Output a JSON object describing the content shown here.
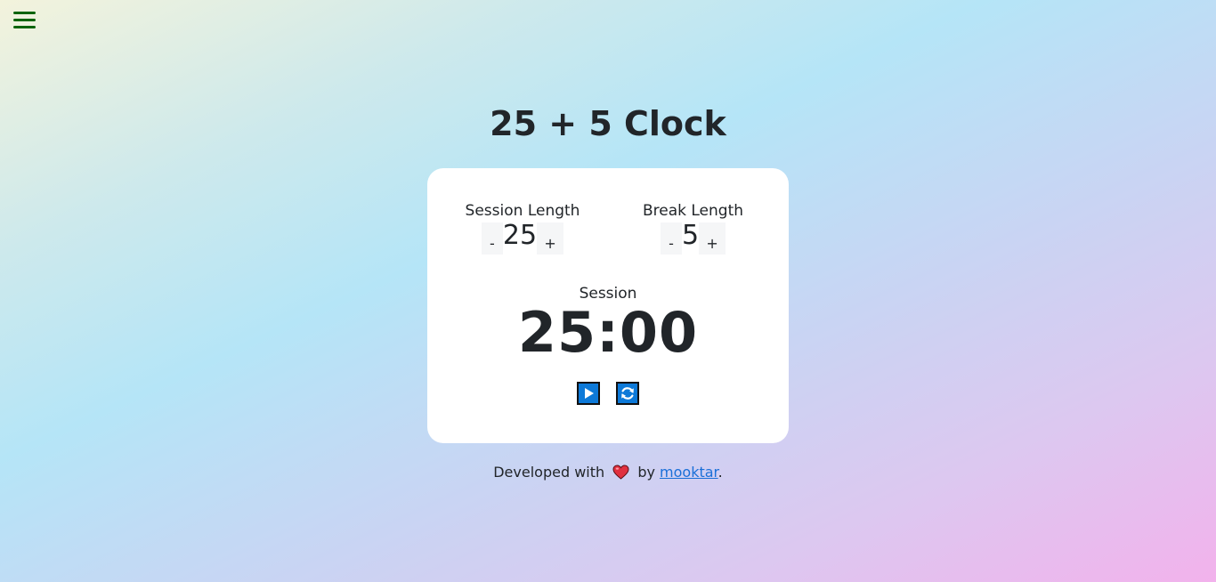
{
  "menu": {
    "icon": "hamburger-menu-icon",
    "color": "#0b640b"
  },
  "title": "25 + 5 Clock",
  "session": {
    "label": "Session Length",
    "value": "25",
    "decrement_label": "-",
    "increment_label": "+"
  },
  "break": {
    "label": "Break Length",
    "value": "5",
    "decrement_label": "-",
    "increment_label": "+"
  },
  "timer": {
    "label": "Session",
    "time": "25:00"
  },
  "controls": {
    "play_icon": "play-icon",
    "reset_icon": "refresh-icon",
    "accent": "#0d79d8"
  },
  "footer": {
    "prefix": "Developed with",
    "heart_icon": "heart-icon",
    "middle": "by",
    "author": "mooktar",
    "suffix": "."
  }
}
